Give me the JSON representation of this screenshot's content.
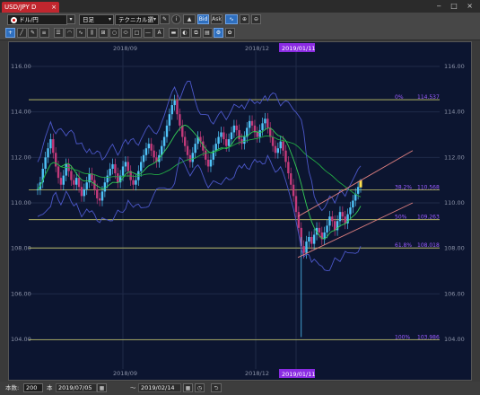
{
  "window": {
    "tab_title": "USD/JPY D",
    "tab_close": "×",
    "controls": "‒ □ ×"
  },
  "toolbar": {
    "symbol": "ドル/円",
    "timeframe": "日足",
    "technical": "テクニカル選択",
    "bid_label": "Bid",
    "ask_label": "Ask",
    "icons": [
      "pencil-icon",
      "info-icon",
      "mountain-chart-icon",
      "bid-button",
      "ask-button",
      "chart-type-icon",
      "zoom-in-icon",
      "zoom-out-icon"
    ]
  },
  "drawing_tools": [
    "crosshair-icon",
    "line-icon",
    "pen-icon",
    "horizontal-lines-icon",
    "parallel-lines-icon",
    "fibonacci-fan-icon",
    "cycle-icon",
    "vertical-bars-icon",
    "gann-icon",
    "circle-icon",
    "ellipse-icon",
    "rectangle-icon",
    "horizontal-line-icon",
    "text-tool-icon",
    "eraser-icon",
    "stamp-icon",
    "copy-icon",
    "layers-icon",
    "settings-icon",
    "palette-icon"
  ],
  "chart": {
    "background": "#0c1530",
    "accent": "#8a2be2",
    "x_labels_top": [
      "2018/09",
      "2018/12",
      "2019/01/11"
    ],
    "x_labels_bottom": [
      "2018/09",
      "2018/12",
      "2019/01/11"
    ],
    "y_ticks": [
      "116.00",
      "114.00",
      "112.00",
      "110.00",
      "108.00",
      "106.00",
      "104.00"
    ],
    "fibonacci": [
      {
        "pct": "0%",
        "price": "114.537"
      },
      {
        "pct": "38.2%",
        "price": "110.568"
      },
      {
        "pct": "50%",
        "price": "109.263"
      },
      {
        "pct": "61.8%",
        "price": "108.018"
      },
      {
        "pct": "100%",
        "price": "103.986"
      }
    ]
  },
  "bottom": {
    "count_label": "本数:",
    "count_value": "200",
    "unit": "本",
    "date_from": "2019/07/05",
    "tilde": "〜",
    "date_to": "2019/02/14"
  }
}
